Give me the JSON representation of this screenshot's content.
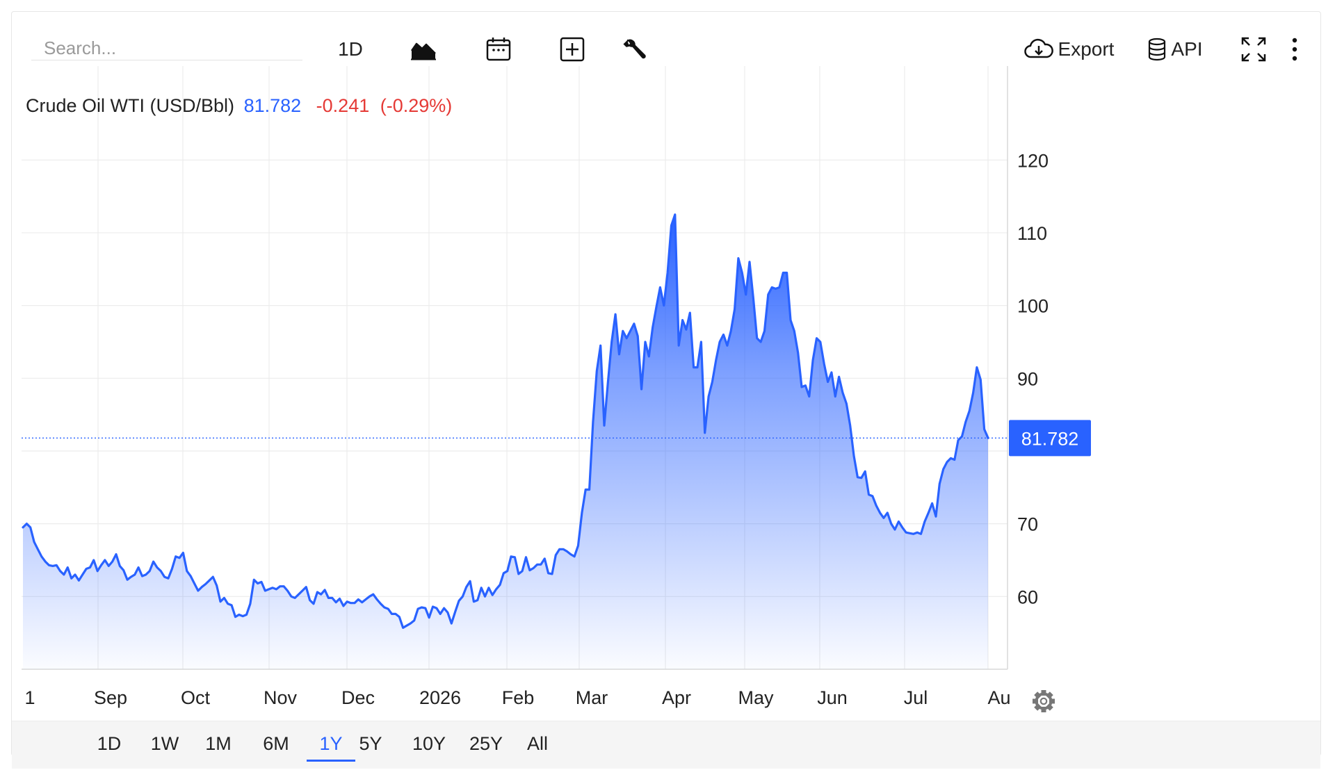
{
  "toolbar": {
    "search_placeholder": "Search...",
    "interval_label": "1D",
    "export_label": "Export",
    "api_label": "API"
  },
  "legend": {
    "name": "Crude Oil WTI (USD/Bbl)",
    "price": "81.782",
    "change": "-0.241",
    "change_pct": "(-0.29%)"
  },
  "ranges": [
    "1D",
    "1W",
    "1M",
    "6M",
    "1Y",
    "5Y",
    "10Y",
    "25Y",
    "All"
  ],
  "active_range": "1Y",
  "colors": {
    "line": "#2962ff",
    "area_top": "#2962ff",
    "down": "#e53935",
    "grid": "#ececec"
  },
  "chart_data": {
    "type": "area",
    "title": "Crude Oil WTI (USD/Bbl)",
    "xlabel": "",
    "ylabel": "",
    "ylim": [
      50,
      127
    ],
    "y_ticks": [
      60,
      70,
      80,
      90,
      100,
      110,
      120
    ],
    "y_tick_labels": [
      "60",
      "70",
      "",
      "90",
      "100",
      "110",
      "120"
    ],
    "x_tick_labels": [
      "1",
      "Sep",
      "Oct",
      "Nov",
      "Dec",
      "2026",
      "Feb",
      "Mar",
      "Apr",
      "May",
      "Jun",
      "Jul",
      "Au"
    ],
    "last_value": 81.782,
    "last_value_label": "81.782",
    "grid": true,
    "series": [
      {
        "values": [
          69.5,
          70.0,
          69.5,
          67.5,
          66.5,
          65.5,
          64.8,
          64.3,
          64.2,
          64.3,
          63.5,
          63.0,
          64.0,
          62.5,
          63.0,
          62.2,
          63.0,
          63.8,
          64.0,
          65.0,
          63.5,
          64.3,
          65.0,
          64.2,
          64.8,
          65.8,
          64.2,
          63.6,
          62.3,
          62.7,
          63.0,
          64.0,
          62.8,
          63.0,
          63.5,
          64.8,
          64.0,
          63.5,
          62.7,
          62.5,
          63.8,
          65.5,
          65.3,
          66.0,
          63.5,
          62.8,
          61.8,
          60.8,
          61.3,
          61.7,
          62.2,
          62.7,
          61.5,
          59.3,
          59.8,
          59.0,
          58.8,
          57.2,
          57.5,
          57.3,
          57.5,
          59.0,
          62.3,
          61.8,
          62.0,
          60.8,
          61.0,
          61.2,
          61.0,
          61.4,
          61.4,
          60.8,
          60.0,
          59.8,
          60.3,
          60.8,
          61.3,
          59.5,
          59.0,
          60.6,
          60.3,
          60.9,
          59.8,
          59.8,
          59.2,
          59.7,
          58.7,
          59.3,
          59.1,
          59.1,
          59.6,
          59.2,
          59.6,
          60.0,
          60.3,
          59.6,
          59.0,
          58.5,
          58.3,
          57.6,
          57.6,
          57.2,
          55.7,
          56.0,
          56.3,
          56.7,
          58.3,
          58.5,
          58.4,
          57.1,
          58.6,
          58.4,
          57.6,
          58.4,
          57.8,
          56.3,
          57.9,
          59.4,
          60.0,
          61.3,
          62.1,
          59.3,
          59.5,
          61.2,
          60.0,
          61.2,
          60.2,
          61.0,
          61.6,
          63.2,
          63.5,
          65.5,
          65.4,
          63.1,
          63.5,
          65.4,
          63.6,
          63.9,
          64.4,
          64.4,
          65.2,
          63.2,
          63.1,
          65.7,
          66.5,
          66.5,
          66.2,
          65.8,
          65.5,
          67.0,
          71.5,
          74.7,
          74.7,
          84.0,
          91.0,
          94.5,
          83.5,
          89.5,
          95.0,
          98.8,
          93.3,
          96.5,
          95.5,
          96.5,
          97.5,
          95.8,
          88.5,
          95.0,
          93.0,
          97.0,
          99.8,
          102.5,
          100.0,
          104.5,
          111.0,
          112.5,
          94.5,
          98.0,
          96.7,
          99.0,
          91.5,
          91.5,
          95.0,
          82.5,
          87.5,
          89.5,
          92.5,
          95.0,
          96.0,
          94.5,
          96.5,
          99.5,
          106.5,
          104.5,
          101.5,
          106.0,
          101.0,
          95.5,
          95.0,
          96.5,
          101.5,
          102.5,
          102.3,
          102.5,
          104.5,
          104.5,
          98.0,
          96.5,
          93.5,
          88.8,
          89.0,
          87.5,
          92.5,
          95.5,
          95.0,
          92.0,
          89.5,
          90.8,
          87.5,
          90.2,
          88.0,
          86.5,
          83.5,
          79.3,
          76.4,
          76.3,
          77.2,
          74.0,
          73.8,
          72.5,
          71.5,
          70.8,
          71.5,
          70.0,
          69.2,
          70.3,
          69.5,
          68.8,
          68.7,
          68.6,
          68.8,
          68.6,
          70.3,
          71.5,
          72.8,
          71.0,
          75.5,
          77.5,
          78.5,
          79.0,
          78.8,
          81.5,
          82.0,
          84.0,
          85.5,
          88.0,
          91.5,
          89.8,
          83.0,
          81.782
        ]
      }
    ]
  }
}
